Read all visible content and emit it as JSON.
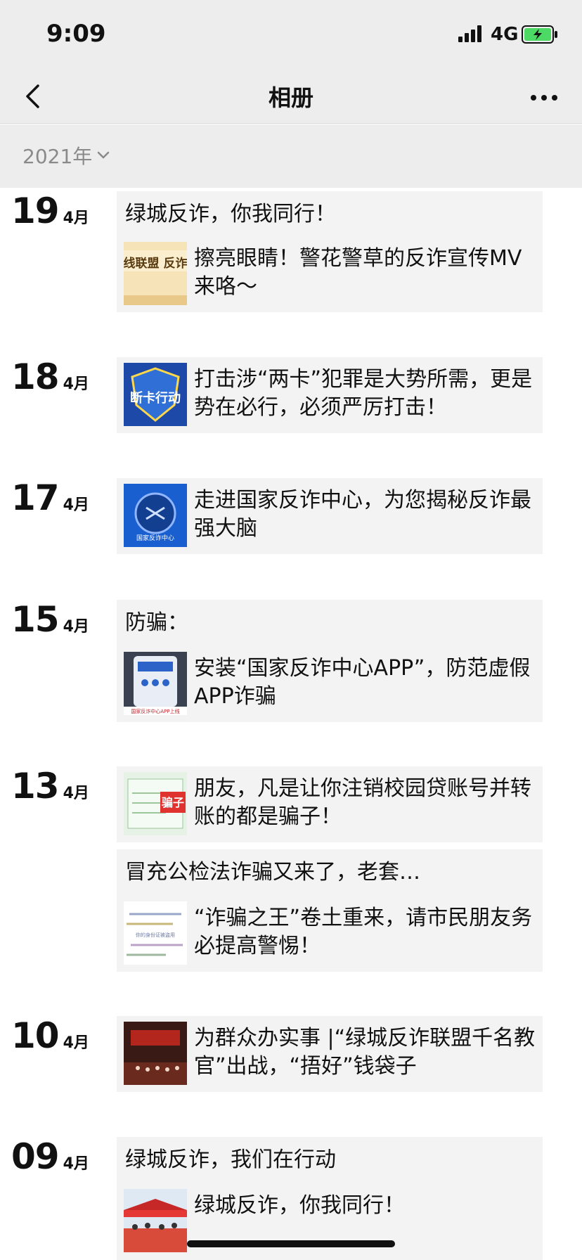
{
  "status_bar": {
    "time": "9:09",
    "network": "4G"
  },
  "nav": {
    "title": "相册"
  },
  "year_filter": {
    "label": "2021年"
  },
  "days": [
    {
      "day": "19",
      "month": "4月",
      "posts": [
        {
          "text": "绿城反诈，你我同行！",
          "article": {
            "title": "擦亮眼睛！警花警草的反诈宣传MV来咯～",
            "thumb_text": "阵线联盟 反诈版"
          }
        }
      ]
    },
    {
      "day": "18",
      "month": "4月",
      "posts": [
        {
          "text": "",
          "article": {
            "title": "打击涉“两卡”犯罪是大势所需，更是势在必行，必须严厉打击！",
            "thumb_text": "断卡行动"
          }
        }
      ]
    },
    {
      "day": "17",
      "month": "4月",
      "posts": [
        {
          "text": "",
          "article": {
            "title": "走进国家反诈中心，为您揭秘反诈最强大脑",
            "thumb_text": "国家反诈中心"
          }
        }
      ]
    },
    {
      "day": "15",
      "month": "4月",
      "posts": [
        {
          "text": "防骗：",
          "article": {
            "title": "安装“国家反诈中心APP”，防范虚假APP诈骗",
            "thumb_text": "国家反诈中心APP上线"
          }
        }
      ]
    },
    {
      "day": "13",
      "month": "4月",
      "posts": [
        {
          "text": "",
          "article": {
            "title": "朋友，凡是让你注销校园贷账号并转账的都是骗子！",
            "thumb_text": "骗子"
          }
        },
        {
          "text": "冒充公检法诈骗又来了，老套…",
          "article": {
            "title": "“诈骗之王”卷土重来，请市民朋友务必提高警惕！",
            "thumb_text": "你的身份证被盗用"
          }
        }
      ]
    },
    {
      "day": "10",
      "month": "4月",
      "posts": [
        {
          "text": "",
          "article": {
            "title": "为群众办实事 |“绿城反诈联盟千名教官”出战，“捂好”钱袋子",
            "thumb_text": ""
          }
        }
      ]
    },
    {
      "day": "09",
      "month": "4月",
      "posts": [
        {
          "text": "绿城反诈，我们在行动",
          "article": {
            "title": "绿城反诈，你我同行！",
            "thumb_text": ""
          }
        }
      ]
    }
  ],
  "colors": {
    "bar_bg": "#ededed",
    "card_bg": "#f3f3f3",
    "muted_text": "#8a8a8a",
    "battery_green": "#4cd964"
  }
}
